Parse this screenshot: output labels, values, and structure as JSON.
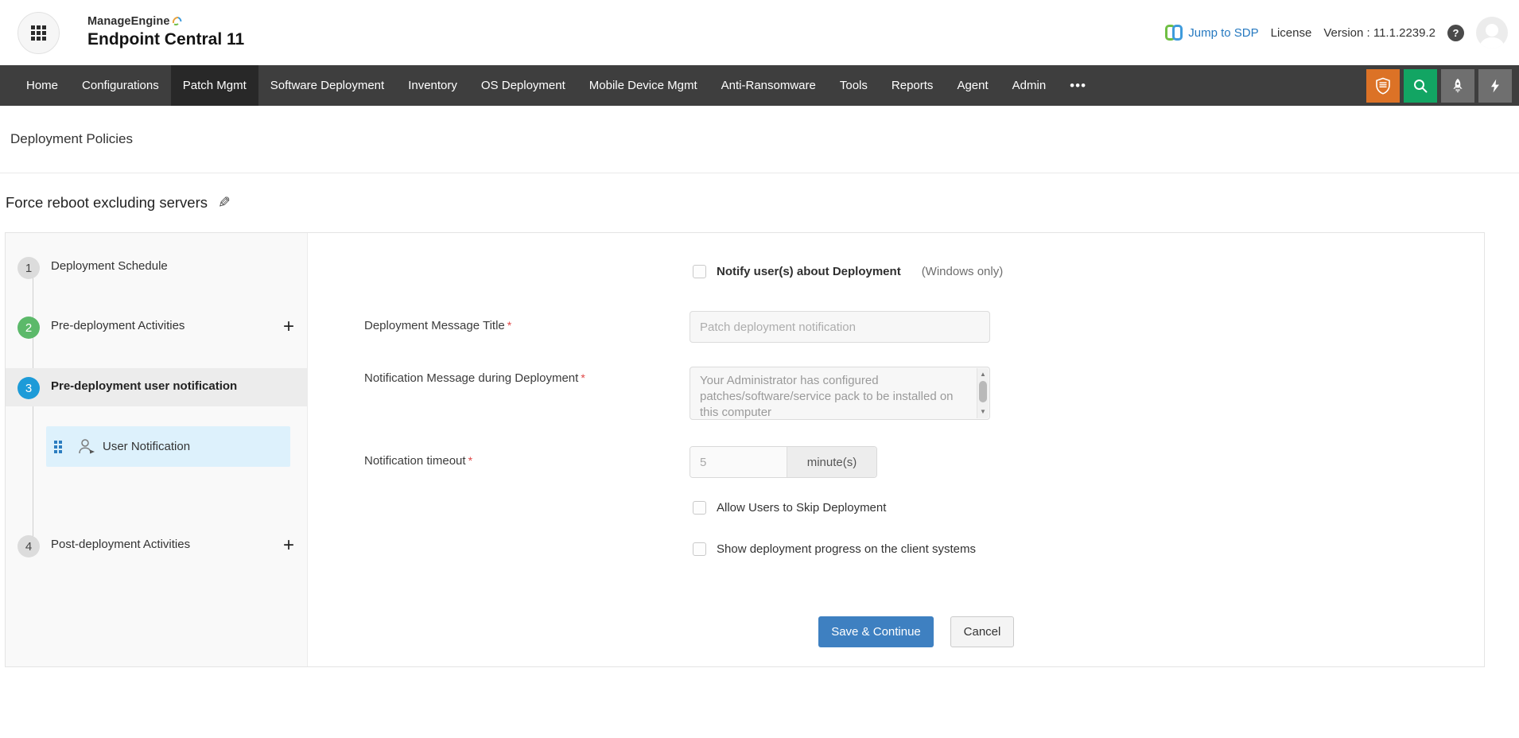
{
  "header": {
    "brand": "ManageEngine",
    "product": "Endpoint Central 11",
    "jump_to_sdp": "Jump to SDP",
    "license": "License",
    "version": "Version : 11.1.2239.2",
    "help_glyph": "?"
  },
  "nav": {
    "active": "Patch Mgmt",
    "more_glyph": "•••",
    "items": [
      {
        "label": "Home"
      },
      {
        "label": "Configurations"
      },
      {
        "label": "Patch Mgmt"
      },
      {
        "label": "Software Deployment"
      },
      {
        "label": "Inventory"
      },
      {
        "label": "OS Deployment"
      },
      {
        "label": "Mobile Device Mgmt"
      },
      {
        "label": "Anti-Ransomware"
      },
      {
        "label": "Tools"
      },
      {
        "label": "Reports"
      },
      {
        "label": "Agent"
      },
      {
        "label": "Admin"
      }
    ]
  },
  "page": {
    "breadcrumb": "Deployment Policies",
    "policy_title": "Force reboot excluding servers"
  },
  "stepper": {
    "steps": [
      {
        "number": "1",
        "label": "Deployment Schedule",
        "state": "pending"
      },
      {
        "number": "2",
        "label": "Pre-deployment Activities",
        "state": "done"
      },
      {
        "number": "3",
        "label": "Pre-deployment user notification",
        "state": "active"
      },
      {
        "number": "4",
        "label": "Post-deployment Activities",
        "state": "pending"
      }
    ],
    "sub_item": {
      "label": "User Notification"
    },
    "plus_glyph": "+"
  },
  "form": {
    "required_marker": "*",
    "notify_checkbox": {
      "label": "Notify user(s) about Deployment",
      "hint": "(Windows only)",
      "checked": false
    },
    "message_title": {
      "label": "Deployment Message Title",
      "placeholder": "Patch deployment notification"
    },
    "notification_message": {
      "label": "Notification Message during Deployment",
      "value": "Your Administrator has configured patches/software/service pack to be installed on this computer"
    },
    "notification_timeout": {
      "label": "Notification timeout",
      "value": "5",
      "unit": "minute(s)"
    },
    "skip_checkbox": {
      "label": "Allow Users to Skip Deployment",
      "checked": false
    },
    "progress_checkbox": {
      "label": "Show deployment progress on the client systems",
      "checked": false
    },
    "buttons": {
      "save": "Save & Continue",
      "cancel": "Cancel"
    }
  },
  "icons": {
    "pencil": "✎",
    "scroll_up": "▲",
    "scroll_down": "▼"
  },
  "colors": {
    "nav_bg": "#3e3e3e",
    "nav_active_bg": "#282828",
    "step_green": "#5cb96a",
    "step_blue": "#1d9bd8",
    "sub_item_bg": "#ddf1fc",
    "save_button": "#3e80c1",
    "link_blue": "#2679c0",
    "icon_orange": "#dc7226",
    "icon_green": "#12a563",
    "required_red": "#e04646"
  }
}
